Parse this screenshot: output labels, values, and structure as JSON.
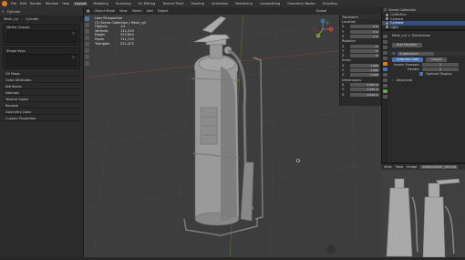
{
  "topbar": {
    "menus": [
      "File",
      "Edit",
      "Render",
      "Window",
      "Help"
    ],
    "workspaces": [
      "Layout",
      "Modeling",
      "Sculpting",
      "UV Editing",
      "Texture Paint",
      "Shading",
      "Animation",
      "Rendering",
      "Compositing",
      "Geometry Nodes",
      "Scripting"
    ],
    "active_workspace": "Layout",
    "scene": "Scene",
    "view_layer": "ViewLayer"
  },
  "left_panel": {
    "header": "Cylinder",
    "sub_header": "Mesh_cyl",
    "sub_header2": "Cylinder",
    "boxes": [
      "Vertex Groups",
      "Shape Keys"
    ],
    "collapsed": [
      "UV Maps",
      "Color Attributes",
      "Attributes",
      "Normals",
      "Texture Space",
      "Remesh",
      "Geometry Data",
      "Custom Properties"
    ]
  },
  "viewport": {
    "toolbar": [
      "Object Mode",
      "View",
      "Select",
      "Add",
      "Object",
      "Global"
    ],
    "stats": {
      "title": "User Perspective",
      "subtitle": "(1) Scene Collection | Mesh_cyl",
      "rows": [
        {
          "label": "Objects",
          "value": "1/1"
        },
        {
          "label": "Vertices",
          "value": "111,510"
        },
        {
          "label": "Edges",
          "value": "222,644"
        },
        {
          "label": "Faces",
          "value": "111,110"
        },
        {
          "label": "Triangles",
          "value": "221,472"
        }
      ]
    },
    "npanel": {
      "header": "Transform",
      "sections": [
        {
          "title": "Location",
          "fields": [
            {
              "k": "X",
              "v": "0 m"
            },
            {
              "k": "Y",
              "v": "0 m"
            },
            {
              "k": "Z",
              "v": "0 m"
            }
          ]
        },
        {
          "title": "Rotation",
          "fields": [
            {
              "k": "X",
              "v": "0°"
            },
            {
              "k": "Y",
              "v": "0°"
            },
            {
              "k": "Z",
              "v": "0°"
            }
          ]
        },
        {
          "title": "Scale",
          "fields": [
            {
              "k": "X",
              "v": "1.000"
            },
            {
              "k": "Y",
              "v": "1.000"
            },
            {
              "k": "Z",
              "v": "1.000"
            }
          ]
        },
        {
          "title": "Dimensions",
          "fields": [
            {
              "k": "X",
              "v": "0.305 m"
            },
            {
              "k": "Y",
              "v": "0.245 m"
            },
            {
              "k": "Z",
              "v": "0.610 m"
            }
          ]
        }
      ]
    },
    "gizmo_labels": [
      "X",
      "Y",
      "Z"
    ]
  },
  "outliner": {
    "header": "Scene Collection",
    "rows": [
      {
        "label": "Collection",
        "selected": false,
        "color": "#9a9a9a"
      },
      {
        "label": "Camera",
        "selected": false,
        "color": "#9a9a9a"
      },
      {
        "label": "Cylinder",
        "selected": true,
        "color": "#e87d0d"
      },
      {
        "label": "Light",
        "selected": false,
        "color": "#9a9a9a"
      }
    ]
  },
  "props": {
    "breadcrumb": "Mesh_cyl  >  Subdivision",
    "add_modifier": "Add Modifier",
    "modifier_name": "Subdivision",
    "tabs": [
      "Catmull-Clark",
      "Simple"
    ],
    "active_tab": "Catmull-Clark",
    "fields": [
      {
        "label": "Levels Viewport",
        "value": "2"
      },
      {
        "label": "Render",
        "value": "2"
      }
    ],
    "checkbox": "Optimal Display",
    "advanced": "Advanced"
  },
  "thumb": {
    "menus": [
      "View",
      "View",
      "Image",
      "extinguisher_ref.png"
    ]
  }
}
